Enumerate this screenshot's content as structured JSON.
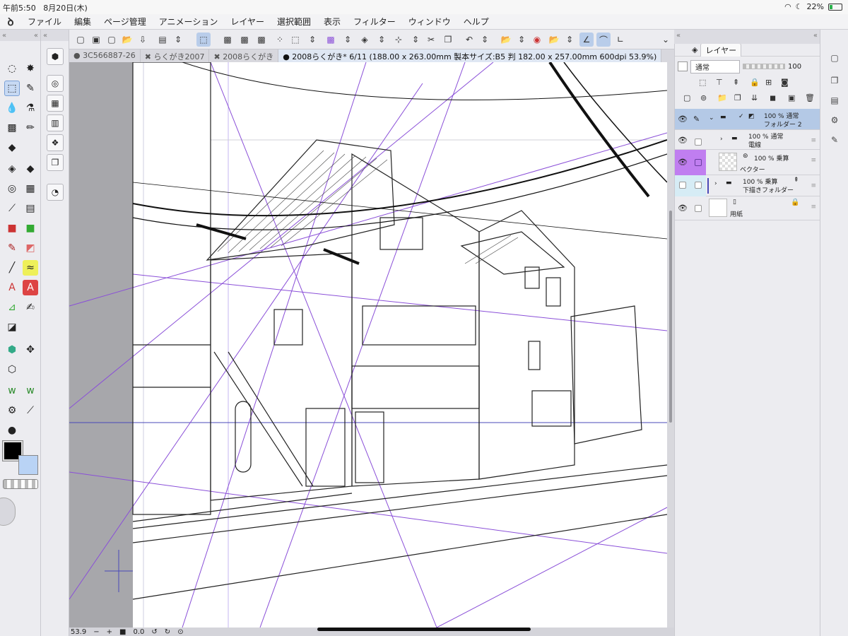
{
  "status_bar": {
    "time": "午前5:50",
    "date": "8月20日(木)",
    "battery": "22%"
  },
  "menu": {
    "items": [
      "ファイル",
      "編集",
      "ページ管理",
      "アニメーション",
      "レイヤー",
      "選択範囲",
      "表示",
      "フィルター",
      "ウィンドウ",
      "ヘルプ"
    ]
  },
  "tabs": [
    {
      "label": "3C566887-26",
      "active": false
    },
    {
      "label": "らくがき2007",
      "active": false
    },
    {
      "label": "2008らくがき",
      "active": false
    },
    {
      "label": "2008らくがき* 6/11 (188.00 x 263.00mm 製本サイズ:B5 判 182.00 x 257.00mm 600dpi 53.9%)",
      "active": true
    }
  ],
  "layer_panel": {
    "tab_label": "レイヤー",
    "blend_mode": "通常",
    "opacity": "100",
    "layers": [
      {
        "line1": "100 % 通常",
        "line2": "フォルダー 2",
        "type": "folder",
        "selected": true
      },
      {
        "line1": "100 % 通常",
        "line2": "電線",
        "type": "folder",
        "selected": false
      },
      {
        "line1": "100 % 乗算",
        "line2": "ベクター",
        "type": "vector",
        "selected": false
      },
      {
        "line1": "100 % 乗算",
        "line2": "下描きフォルダー",
        "type": "folder",
        "selected": false
      },
      {
        "line1": "",
        "line2": "用紙",
        "type": "paper",
        "selected": false
      }
    ]
  },
  "bottom_bar": {
    "zoom": "53.9",
    "angle": "0.0"
  },
  "colors": {
    "main_color": "#000000",
    "sub_color": "#b9d3f5",
    "accent": "#7aa0d6",
    "perspective_lines": "#8a4fd8"
  }
}
